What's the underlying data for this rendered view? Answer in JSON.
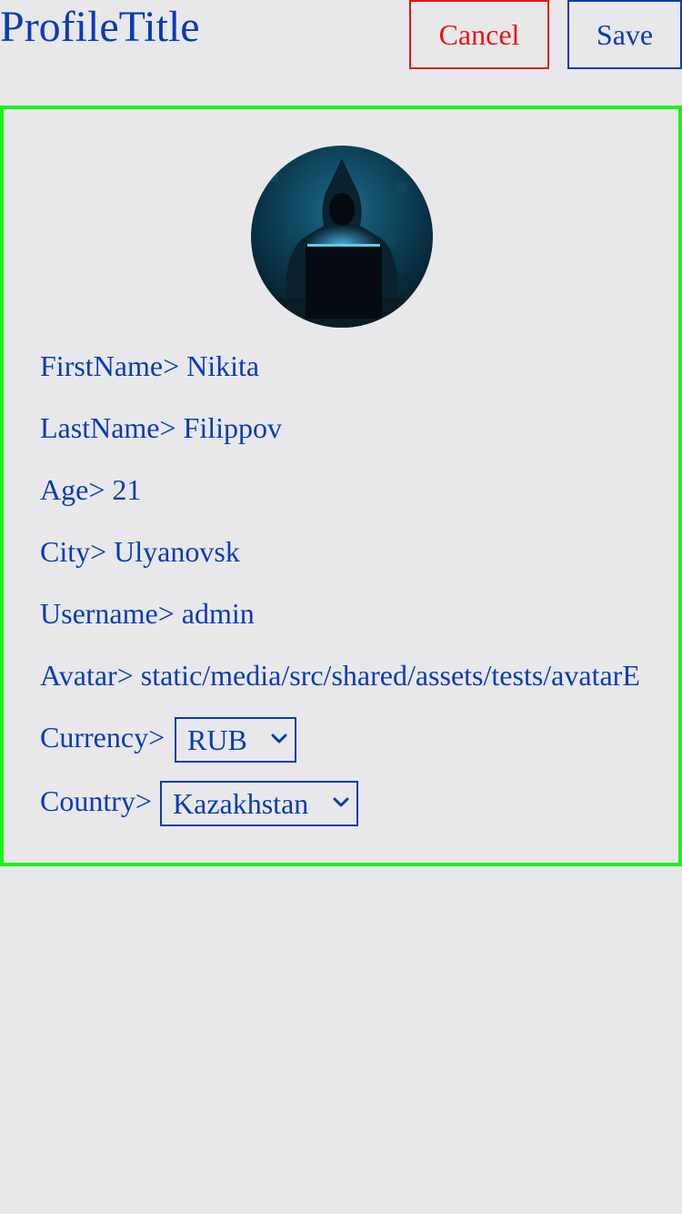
{
  "header": {
    "title": "ProfileTitle",
    "cancel_label": "Cancel",
    "save_label": "Save"
  },
  "profile": {
    "first_name": {
      "label": "FirstName>",
      "value": "Nikita"
    },
    "last_name": {
      "label": "LastName>",
      "value": "Filippov"
    },
    "age": {
      "label": "Age>",
      "value": "21"
    },
    "city": {
      "label": "City>",
      "value": "Ulyanovsk"
    },
    "username": {
      "label": "Username>",
      "value": "admin"
    },
    "avatar": {
      "label": "Avatar>",
      "value": "static/media/src/shared/assets/tests/avatarE"
    },
    "currency": {
      "label": "Currency>",
      "selected": "RUB"
    },
    "country": {
      "label": "Country>",
      "selected": "Kazakhstan"
    }
  },
  "colors": {
    "background": "#e8e8eb",
    "text": "#0a3bb3",
    "cancel": "#ee1111",
    "card_border": "#17f517"
  },
  "icons": {
    "avatar": "hooded-hacker-at-laptop-image",
    "select": "chevron-down-icon"
  }
}
